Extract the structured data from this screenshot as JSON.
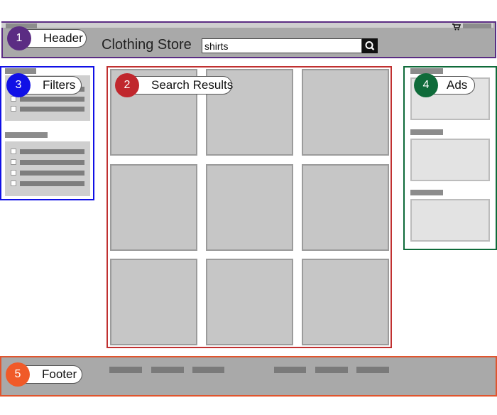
{
  "header": {
    "store_title": "Clothing Store",
    "search_value": "shirts",
    "search_icon": "search-icon",
    "cart_icon": "cart-icon"
  },
  "callouts": [
    {
      "number": "1",
      "label": "Header",
      "color": "#5b2c83"
    },
    {
      "number": "2",
      "label": "Search Results",
      "color": "#c0272d"
    },
    {
      "number": "3",
      "label": "Filters",
      "color": "#1010e6"
    },
    {
      "number": "4",
      "label": "Ads",
      "color": "#0f6b3a"
    },
    {
      "number": "5",
      "label": "Footer",
      "color": "#f05a28"
    }
  ],
  "region_colors": {
    "header": "#5b2c83",
    "search_results": "#c03030",
    "filters": "#1010e6",
    "ads": "#0f6b3a",
    "footer": "#e0552e"
  }
}
